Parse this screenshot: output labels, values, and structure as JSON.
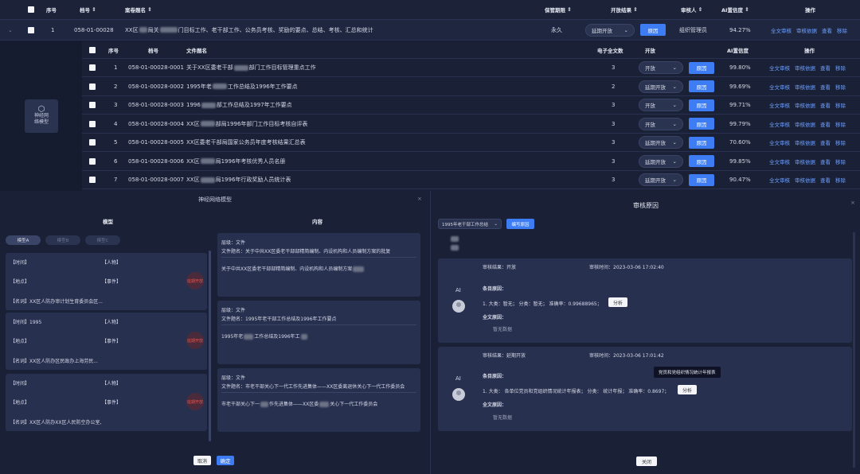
{
  "main_table": {
    "headers": {
      "index": "序号",
      "code": "档号",
      "title": "案卷题名",
      "retention": "保管期限",
      "result": "开放结果",
      "reviewer": "审核人",
      "ai_conf": "AI置信度",
      "ops": "操作"
    },
    "row": {
      "index": "1",
      "code": "058-01-00028",
      "title_prefix": "XX区",
      "title_mid": "局关",
      "title_suffix": "门目标工作、老干部工作、公务员考核、奖励的要点、总结、考核、汇总和统计",
      "retention": "永久",
      "result": "延期开放",
      "reason_btn": "原因",
      "reviewer": "组织管理员",
      "ai_conf": "94.27%",
      "ops": [
        "全文审核",
        "审核依据",
        "查看",
        "移除"
      ]
    }
  },
  "neural_button": {
    "label_line1": "神经网",
    "label_line2": "络模型"
  },
  "sub_table": {
    "headers": {
      "index": "序号",
      "code": "档号",
      "title": "文件题名",
      "pages": "电子全文数",
      "result": "开放",
      "ai_conf": "AI置信度",
      "ops": "操作"
    },
    "rows": [
      {
        "index": "1",
        "code": "058-01-00028-0001",
        "title_a": "关于XX区委老干部",
        "title_b": "部门工作目标管理重点工作",
        "pages": "3",
        "result": "开放",
        "ai_conf": "99.80%"
      },
      {
        "index": "2",
        "code": "058-01-00028-0002",
        "title_a": "1995年老",
        "title_b": "工作总结及1996年工作要点",
        "pages": "2",
        "result": "延期开放",
        "ai_conf": "99.69%"
      },
      {
        "index": "3",
        "code": "058-01-00028-0003",
        "title_a": "1996",
        "title_b": "部工作总结及1997年工作要点",
        "pages": "3",
        "result": "开放",
        "ai_conf": "99.71%"
      },
      {
        "index": "4",
        "code": "058-01-00028-0004",
        "title_a": "XX区",
        "title_b": "部局1996年部门工作目标考核自评表",
        "pages": "3",
        "result": "开放",
        "ai_conf": "99.79%"
      },
      {
        "index": "5",
        "code": "058-01-00028-0005",
        "title_a": "XX区委老干部局国家公务员年度考核结果汇总表",
        "title_b": "",
        "pages": "3",
        "result": "延期开放",
        "ai_conf": "70.60%"
      },
      {
        "index": "6",
        "code": "058-01-00028-0006",
        "title_a": "XX区",
        "title_b": "局1996年考核优秀人员名册",
        "pages": "3",
        "result": "延期开放",
        "ai_conf": "99.85%"
      },
      {
        "index": "7",
        "code": "058-01-00028-0007",
        "title_a": "XX区",
        "title_b": "局1996年行政奖励人员统计表",
        "pages": "3",
        "result": "延期开放",
        "ai_conf": "90.47%"
      }
    ],
    "reason_btn": "原因",
    "ops": [
      "全文审核",
      "审核依据",
      "查看",
      "移除"
    ]
  },
  "nn_panel": {
    "title": "神经网络模型",
    "col_model": "模型",
    "col_content": "内容",
    "pills": [
      "模型A",
      "模型B",
      "模型C"
    ],
    "cards": [
      {
        "time_label": "【时间】",
        "time_value": "",
        "person_label": "【人物】",
        "place_label": "【地点】",
        "event_label": "【事件】",
        "name_label": "【名词】",
        "name_value": "XX区人防办审计划生育委员会区...",
        "stamp": "延期开放"
      },
      {
        "time_label": "【时间】",
        "time_value": "1995",
        "person_label": "【人物】",
        "place_label": "【地点】",
        "event_label": "【事件】",
        "name_label": "【名词】",
        "name_value": "XX区人防办区民政办上海劳民...",
        "stamp": "延期开放"
      },
      {
        "time_label": "【时间】",
        "time_value": "",
        "person_label": "【人物】",
        "place_label": "【地点】",
        "event_label": "【事件】",
        "name_label": "【名词】",
        "name_value": "XX区人防办XX区人民防空办公室,",
        "stamp": "延期开放"
      }
    ],
    "content_cards": [
      {
        "level": "层级：文件",
        "title": "文件题名：关于中共XX区委老干部部精简编制、内设机构和人员编制方案的批复",
        "body": "关于中共XX区委老干部部精简编制、内设机构和人员编制方案"
      },
      {
        "level": "层级：文件",
        "title": "文件题名：1995年老干部工作总结及1996年工作要点",
        "body_a": "1995年老",
        "body_b": "工作总结及1996年工",
        "body_c": ""
      },
      {
        "level": "层级：文件",
        "title": "文件题名：市老干部关心下一代工作先进集体——XX区委离退休关心下一代工作委员会",
        "body_a": "市老干部关心下一",
        "body_b": "作先进集体——XX区委",
        "body_c": "关心下一代工作委员会"
      }
    ],
    "cancel": "取消",
    "confirm": "确定"
  },
  "review_panel": {
    "title": "审核原因",
    "select_value": "1995年老干部工作总结",
    "edit_btn": "编写原因",
    "blocks": [
      {
        "result": "审核结果：开放",
        "time": "审核时间：2023-03-06 17:02:40",
        "ai": "AI",
        "entry_label": "条目原因：",
        "entry": "1. 大类：暂无；  分类：暂无；  准确率：0.99688965；",
        "analyze": "分析",
        "full_label": "全文原因：",
        "full_value": "暂无数据"
      },
      {
        "result": "审核结果：延期开放",
        "time": "审核时间：2023-03-06 17:01:42",
        "ai": "AI",
        "entry_label": "条目原因：",
        "entry": "1. 大类：  各单位党员和党组织情况统计年报表；  分类：  统计年报；  准确率：0.8697；",
        "analyze": "分析",
        "full_label": "全文原因：",
        "full_value": "暂无数据",
        "tooltip": "党员和党组织情况统计年报表"
      }
    ],
    "close": "关闭"
  },
  "colors": {
    "accent": "#3d7cf2",
    "link": "#6ea0ff",
    "stamp": "#e0564f"
  }
}
